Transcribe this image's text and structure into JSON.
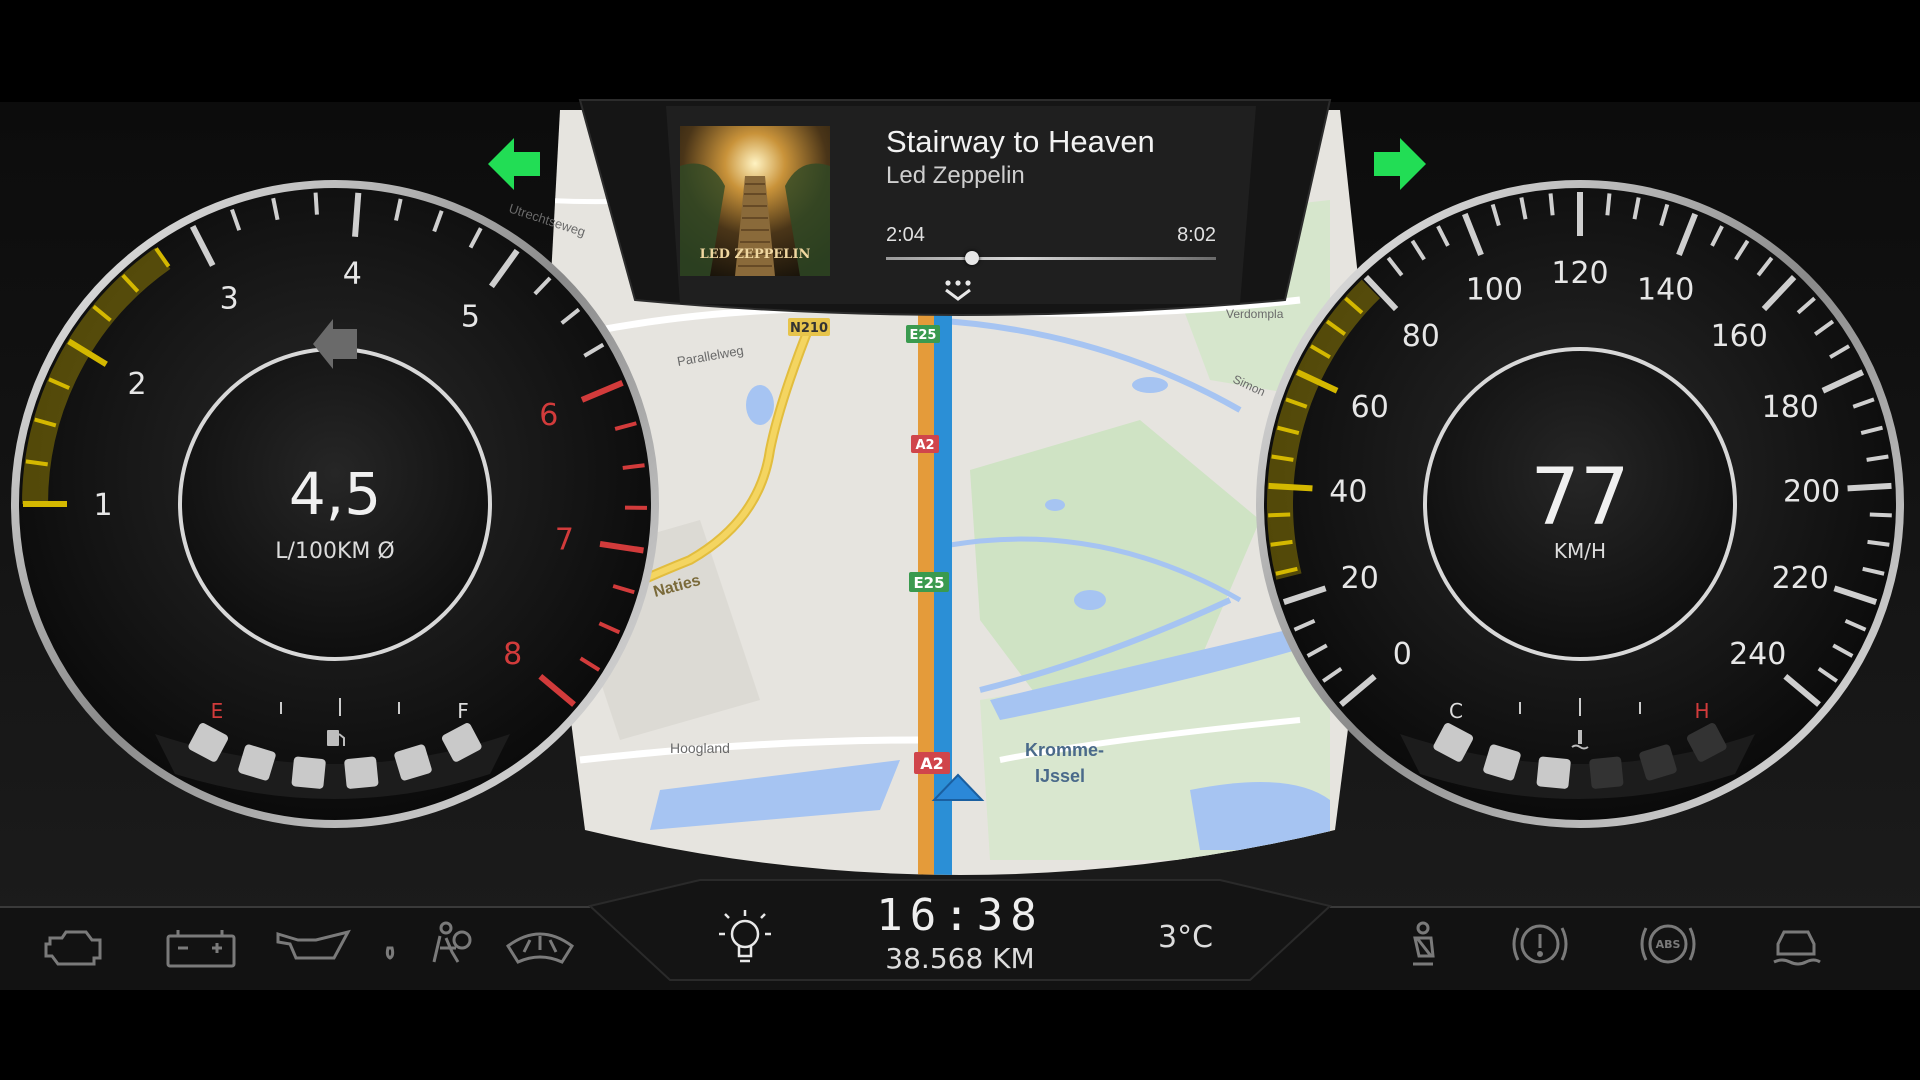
{
  "media": {
    "album_art": "album-art-led-zeppelin-stairway",
    "album_text": "LED ZEPPELIN",
    "song_title": "Stairway to Heaven",
    "artist": "Led Zeppelin",
    "elapsed": "2:04",
    "duration": "8:02",
    "progress_fraction": 0.26,
    "expand_icon": "chevron-down-icon"
  },
  "turn_signals": {
    "left": "arrow-left-icon",
    "right": "arrow-right-icon",
    "color": "#22dd55"
  },
  "left_gauge": {
    "type": "tachometer",
    "ticks": [
      "1",
      "2",
      "3",
      "4",
      "5",
      "6",
      "7",
      "8"
    ],
    "red_ticks": [
      "6",
      "7",
      "8"
    ],
    "center_value": "4,5",
    "center_unit": "L/100KM Ø",
    "center_icon": "nav-arrow-left-icon",
    "fuel_empty_label": "E",
    "fuel_full_label": "F",
    "fuel_icon": "fuel-pump-icon",
    "fuel_segments_lit": 6,
    "fuel_segments_total": 6,
    "accent_color": "#d4b800"
  },
  "right_gauge": {
    "type": "speedometer",
    "ticks": [
      "0",
      "20",
      "40",
      "60",
      "80",
      "100",
      "120",
      "140",
      "160",
      "180",
      "200",
      "220",
      "240"
    ],
    "center_value": "77",
    "center_unit": "KM/H",
    "temp_cold_label": "C",
    "temp_hot_label": "H",
    "temp_icon": "coolant-temperature-icon",
    "temp_segments_lit": 3,
    "accent_color": "#d4b800"
  },
  "map": {
    "labels": {
      "utrechtseweg": "Utrechtseweg",
      "parallelweg": "Parallelweg",
      "naties": "Naties",
      "hoogland": "Hoogland",
      "kromme1": "Kromme-",
      "kromme2": "IJssel",
      "n210": "N210",
      "e25a": "E25",
      "a2a": "A2",
      "e25b": "E25",
      "a2b": "A2",
      "verdompla": "Verdompla",
      "simons": "Simon"
    },
    "position_marker": "navigation-arrow-icon"
  },
  "footer": {
    "clock": "16:38",
    "odometer": "38.568 KM",
    "outside_temp": "3°C",
    "light_icon": "light-bulb-icon",
    "left_warnings": [
      "check-engine-icon",
      "battery-icon",
      "oil-pressure-icon",
      "airbag-icon",
      "washer-fluid-icon"
    ],
    "right_warnings": [
      "seatbelt-icon",
      "brake-warning-icon",
      "abs-icon",
      "traction-control-icon"
    ]
  }
}
